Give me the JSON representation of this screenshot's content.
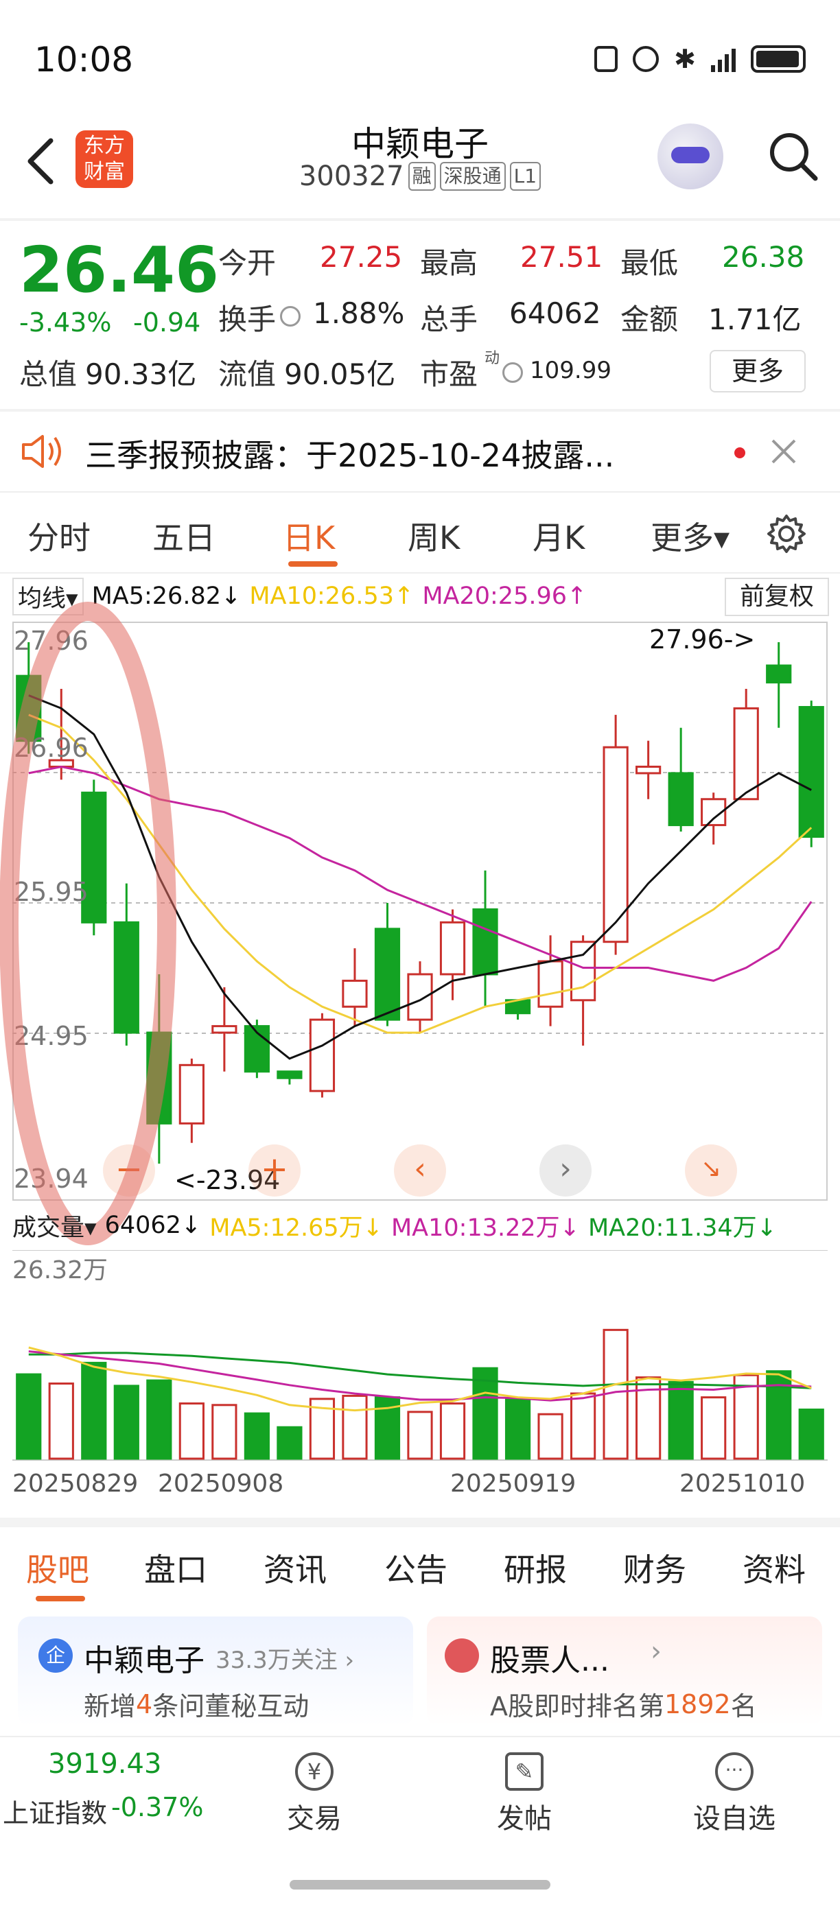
{
  "status_bar": {
    "time": "10:08"
  },
  "header": {
    "logo_line1": "东方",
    "logo_line2": "财富",
    "stock_name": "中颖电子",
    "stock_code": "300327",
    "tags": [
      "融",
      "深股通",
      "L1"
    ]
  },
  "quote": {
    "price": "26.46",
    "change_pct": "-3.43%",
    "change": "-0.94",
    "open_label": "今开",
    "open": "27.25",
    "high_label": "最高",
    "high": "27.51",
    "low_label": "最低",
    "low": "26.38",
    "turnover_label": "换手",
    "turnover": "1.88%",
    "volume_label": "总手",
    "volume": "64062",
    "amount_label": "金额",
    "amount": "1.71亿",
    "mktcap_label": "总值",
    "mktcap": "90.33亿",
    "float_label": "流值",
    "float_cap": "90.05亿",
    "pe_label": "市盈",
    "pe_sup": "动",
    "pe": "109.99",
    "more_button": "更多"
  },
  "notice": {
    "text": "三季报预披露：于2025-10-24披露..."
  },
  "period_tabs": [
    "分时",
    "五日",
    "日K",
    "周K",
    "月K",
    "更多▾"
  ],
  "active_tab": "日K",
  "ma_bar": {
    "selector": "均线▾",
    "ma5": "MA5:26.82↓",
    "ma10": "MA10:26.53↑",
    "ma20": "MA20:25.96↑",
    "adjust": "前复权"
  },
  "price_chart": {
    "y_labels": [
      "27.96",
      "26.96",
      "25.95",
      "24.95",
      "23.94"
    ],
    "max_marker": "27.96->",
    "min_marker": "<-23.94"
  },
  "volume_bar": {
    "selector": "成交量▾",
    "value": "64062↓",
    "ma5": "MA5:12.65万↓",
    "ma10": "MA10:13.22万↓",
    "ma20": "MA20:11.34万↓",
    "max_label": "26.32万"
  },
  "dates": [
    "20250829",
    "20250908",
    "20250919",
    "20251010"
  ],
  "colors": {
    "up": "#c9302c",
    "down": "#13a323",
    "ma5": "#111111",
    "ma10": "#f2cf3a",
    "ma20": "#c4249e",
    "accent": "#e8652a"
  },
  "chart_data": {
    "type": "candlestick",
    "ylim": [
      23.94,
      27.96
    ],
    "candles": [
      {
        "o": 27.7,
        "c": 27.2,
        "h": 27.96,
        "l": 27.1
      },
      {
        "o": 27.0,
        "c": 27.05,
        "h": 27.6,
        "l": 26.9
      },
      {
        "o": 26.8,
        "c": 25.8,
        "h": 26.9,
        "l": 25.7
      },
      {
        "o": 25.8,
        "c": 24.95,
        "h": 26.1,
        "l": 24.85
      },
      {
        "o": 24.95,
        "c": 24.25,
        "h": 25.4,
        "l": 23.94
      },
      {
        "o": 24.25,
        "c": 24.7,
        "h": 24.75,
        "l": 24.1
      },
      {
        "o": 24.95,
        "c": 25.0,
        "h": 25.3,
        "l": 24.65
      },
      {
        "o": 25.0,
        "c": 24.65,
        "h": 25.05,
        "l": 24.6
      },
      {
        "o": 24.65,
        "c": 24.6,
        "h": 24.65,
        "l": 24.55
      },
      {
        "o": 24.5,
        "c": 25.05,
        "h": 25.1,
        "l": 24.45
      },
      {
        "o": 25.15,
        "c": 25.35,
        "h": 25.6,
        "l": 25.0
      },
      {
        "o": 25.75,
        "c": 25.05,
        "h": 25.95,
        "l": 25.0
      },
      {
        "o": 25.05,
        "c": 25.4,
        "h": 25.5,
        "l": 24.95
      },
      {
        "o": 25.4,
        "c": 25.8,
        "h": 25.9,
        "l": 25.2
      },
      {
        "o": 25.9,
        "c": 25.4,
        "h": 26.2,
        "l": 25.15
      },
      {
        "o": 25.2,
        "c": 25.1,
        "h": 25.2,
        "l": 25.05
      },
      {
        "o": 25.15,
        "c": 25.5,
        "h": 25.7,
        "l": 25.0
      },
      {
        "o": 25.2,
        "c": 25.65,
        "h": 25.7,
        "l": 24.85
      },
      {
        "o": 25.65,
        "c": 27.15,
        "h": 27.4,
        "l": 25.55
      },
      {
        "o": 26.95,
        "c": 27.0,
        "h": 27.2,
        "l": 26.75
      },
      {
        "o": 26.95,
        "c": 26.55,
        "h": 27.3,
        "l": 26.5
      },
      {
        "o": 26.55,
        "c": 26.75,
        "h": 26.8,
        "l": 26.4
      },
      {
        "o": 26.75,
        "c": 27.45,
        "h": 27.6,
        "l": 26.75
      },
      {
        "o": 27.78,
        "c": 27.65,
        "h": 27.96,
        "l": 27.3
      },
      {
        "o": 27.46,
        "c": 26.46,
        "h": 27.51,
        "l": 26.38
      }
    ],
    "ma5": [
      27.55,
      27.45,
      27.25,
      26.8,
      26.15,
      25.65,
      25.25,
      24.95,
      24.75,
      24.85,
      25.0,
      25.1,
      25.2,
      25.35,
      25.4,
      25.45,
      25.5,
      25.55,
      25.8,
      26.1,
      26.35,
      26.6,
      26.8,
      26.95,
      26.82
    ],
    "ma10": [
      27.4,
      27.3,
      27.05,
      26.75,
      26.4,
      26.05,
      25.75,
      25.5,
      25.3,
      25.15,
      25.05,
      24.95,
      24.95,
      25.05,
      25.15,
      25.2,
      25.25,
      25.3,
      25.45,
      25.6,
      25.75,
      25.9,
      26.1,
      26.3,
      26.53
    ],
    "ma20": [
      26.95,
      27.0,
      26.95,
      26.85,
      26.75,
      26.7,
      26.65,
      26.55,
      26.45,
      26.3,
      26.2,
      26.05,
      25.95,
      25.85,
      25.75,
      25.65,
      25.55,
      25.45,
      25.45,
      25.45,
      25.4,
      25.35,
      25.45,
      25.6,
      25.96
    ],
    "volumes": [
      11.0,
      9.8,
      12.5,
      9.5,
      10.2,
      7.2,
      7.0,
      5.9,
      4.1,
      7.8,
      8.2,
      8.0,
      6.1,
      7.2,
      11.8,
      7.9,
      5.8,
      8.5,
      16.8,
      10.6,
      10.0,
      8.0,
      10.9,
      11.4,
      6.4
    ],
    "vol_ma5": [
      14.5,
      13.4,
      12.0,
      11.2,
      10.7,
      10.0,
      9.2,
      8.3,
      7.0,
      6.6,
      6.3,
      6.6,
      7.3,
      7.5,
      8.6,
      8.0,
      7.8,
      8.5,
      9.7,
      10.5,
      10.2,
      10.6,
      11.1,
      11.0,
      9.2
    ],
    "vol_ma10": [
      14.0,
      13.6,
      13.2,
      12.8,
      12.4,
      11.7,
      11.0,
      10.3,
      9.6,
      9.0,
      8.5,
      8.1,
      7.7,
      7.7,
      8.0,
      7.9,
      7.6,
      7.9,
      8.7,
      9.0,
      9.1,
      9.0,
      9.4,
      9.6,
      9.4
    ],
    "vol_ma20": [
      13.6,
      13.6,
      13.8,
      13.8,
      13.6,
      13.4,
      13.1,
      12.8,
      12.5,
      12.0,
      11.5,
      11.0,
      10.7,
      10.4,
      10.2,
      9.9,
      9.7,
      9.5,
      9.7,
      9.7,
      9.7,
      9.6,
      9.5,
      9.4,
      9.2
    ],
    "vol_ylim": [
      0,
      26.32
    ]
  },
  "bottom_tabs": [
    "股吧",
    "盘口",
    "资讯",
    "公告",
    "研报",
    "财务",
    "资料"
  ],
  "active_bottom_tab": "股吧",
  "card_left": {
    "badge": "企",
    "title": "中颖电子",
    "follow": "33.3万关注 ›",
    "desc_prefix": "新增",
    "desc_num": "4",
    "desc_suffix": "条问董秘互动"
  },
  "card_right": {
    "title": "股票人...",
    "arrow": "›",
    "desc_prefix": "A股即时排名第",
    "desc_num": "1892",
    "desc_suffix": "名"
  },
  "bottom_nav": {
    "index_value": "3919.43",
    "index_name": "上证指数",
    "index_change": "-0.37%",
    "trade": "交易",
    "post": "发帖",
    "watchlist": "设自选"
  }
}
